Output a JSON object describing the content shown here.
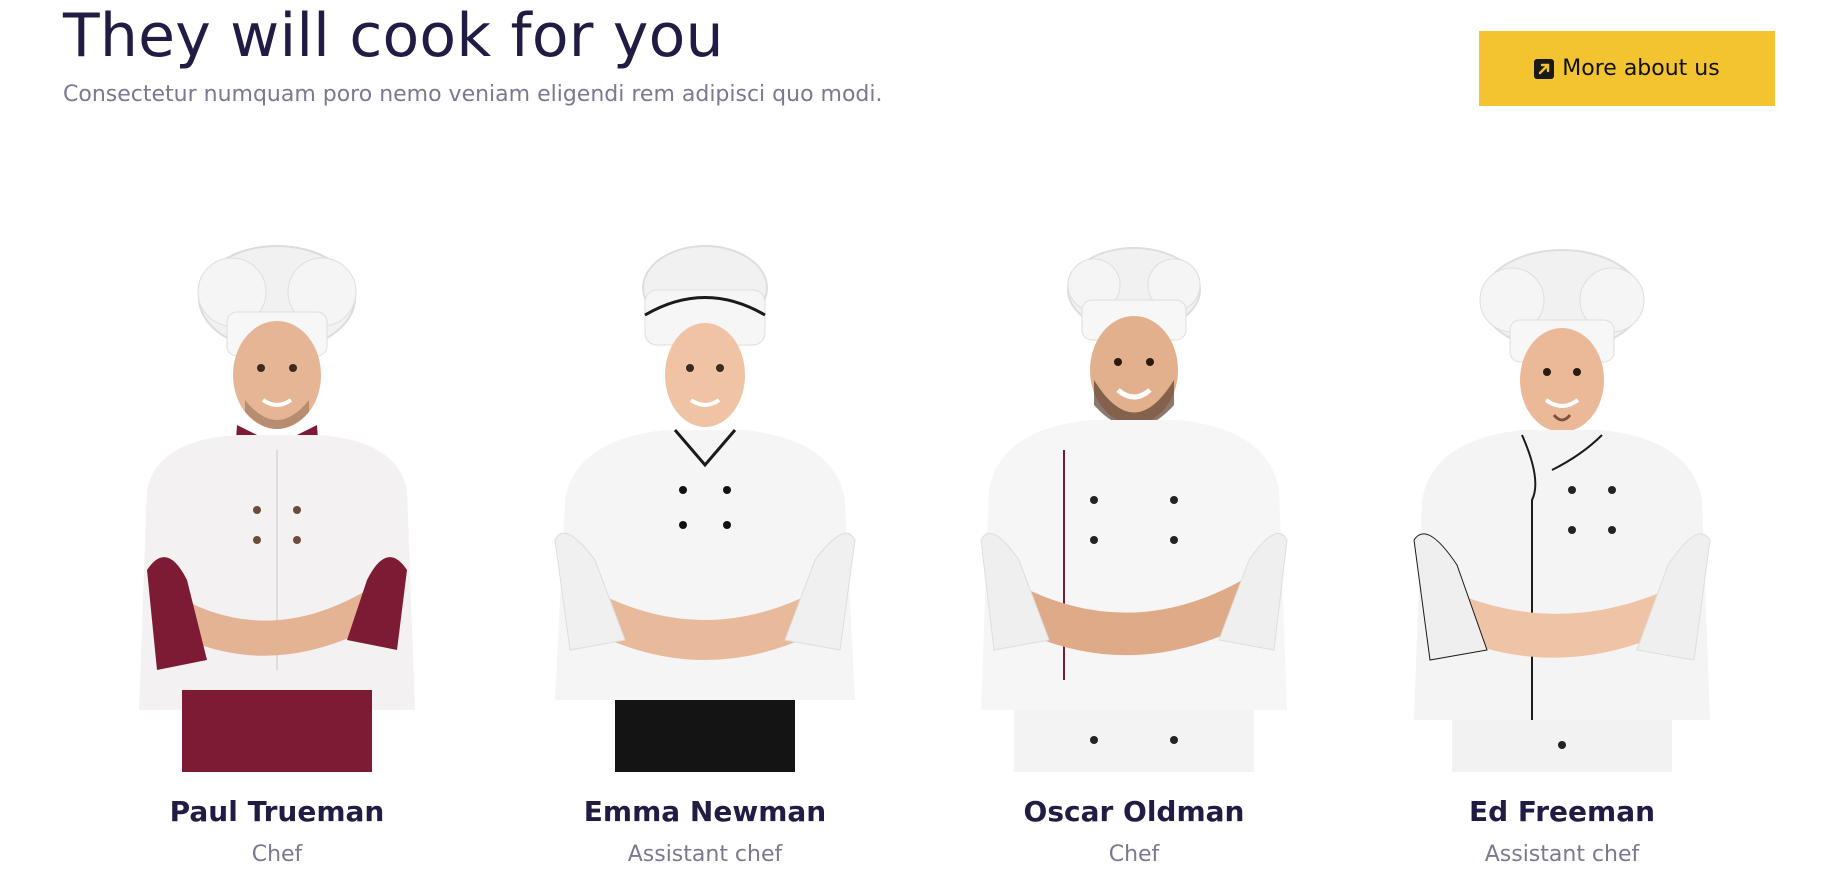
{
  "header": {
    "title": "They will cook for you",
    "subtitle": "Consectetur numquam poro nemo veniam eligendi rem adipisci quo modi."
  },
  "cta": {
    "label": "More about us",
    "icon": "external-link-icon",
    "color": "#f4c430"
  },
  "team": [
    {
      "name": "Paul Trueman",
      "role": "Chef",
      "jacket_accent": "#7d1b34",
      "apron": "#7d1b34"
    },
    {
      "name": "Emma Newman",
      "role": "Assistant chef",
      "jacket_accent": "#1b1b1b",
      "apron": "#141414"
    },
    {
      "name": "Oscar Oldman",
      "role": "Chef",
      "jacket_accent": "#7d1b34",
      "apron": "#f3f3f3"
    },
    {
      "name": "Ed Freeman",
      "role": "Assistant chef",
      "jacket_accent": "#1b1b1b",
      "apron": "#f3f3f3"
    }
  ],
  "colors": {
    "title": "#201c44",
    "muted": "#7b7891",
    "accent": "#f4c430"
  }
}
